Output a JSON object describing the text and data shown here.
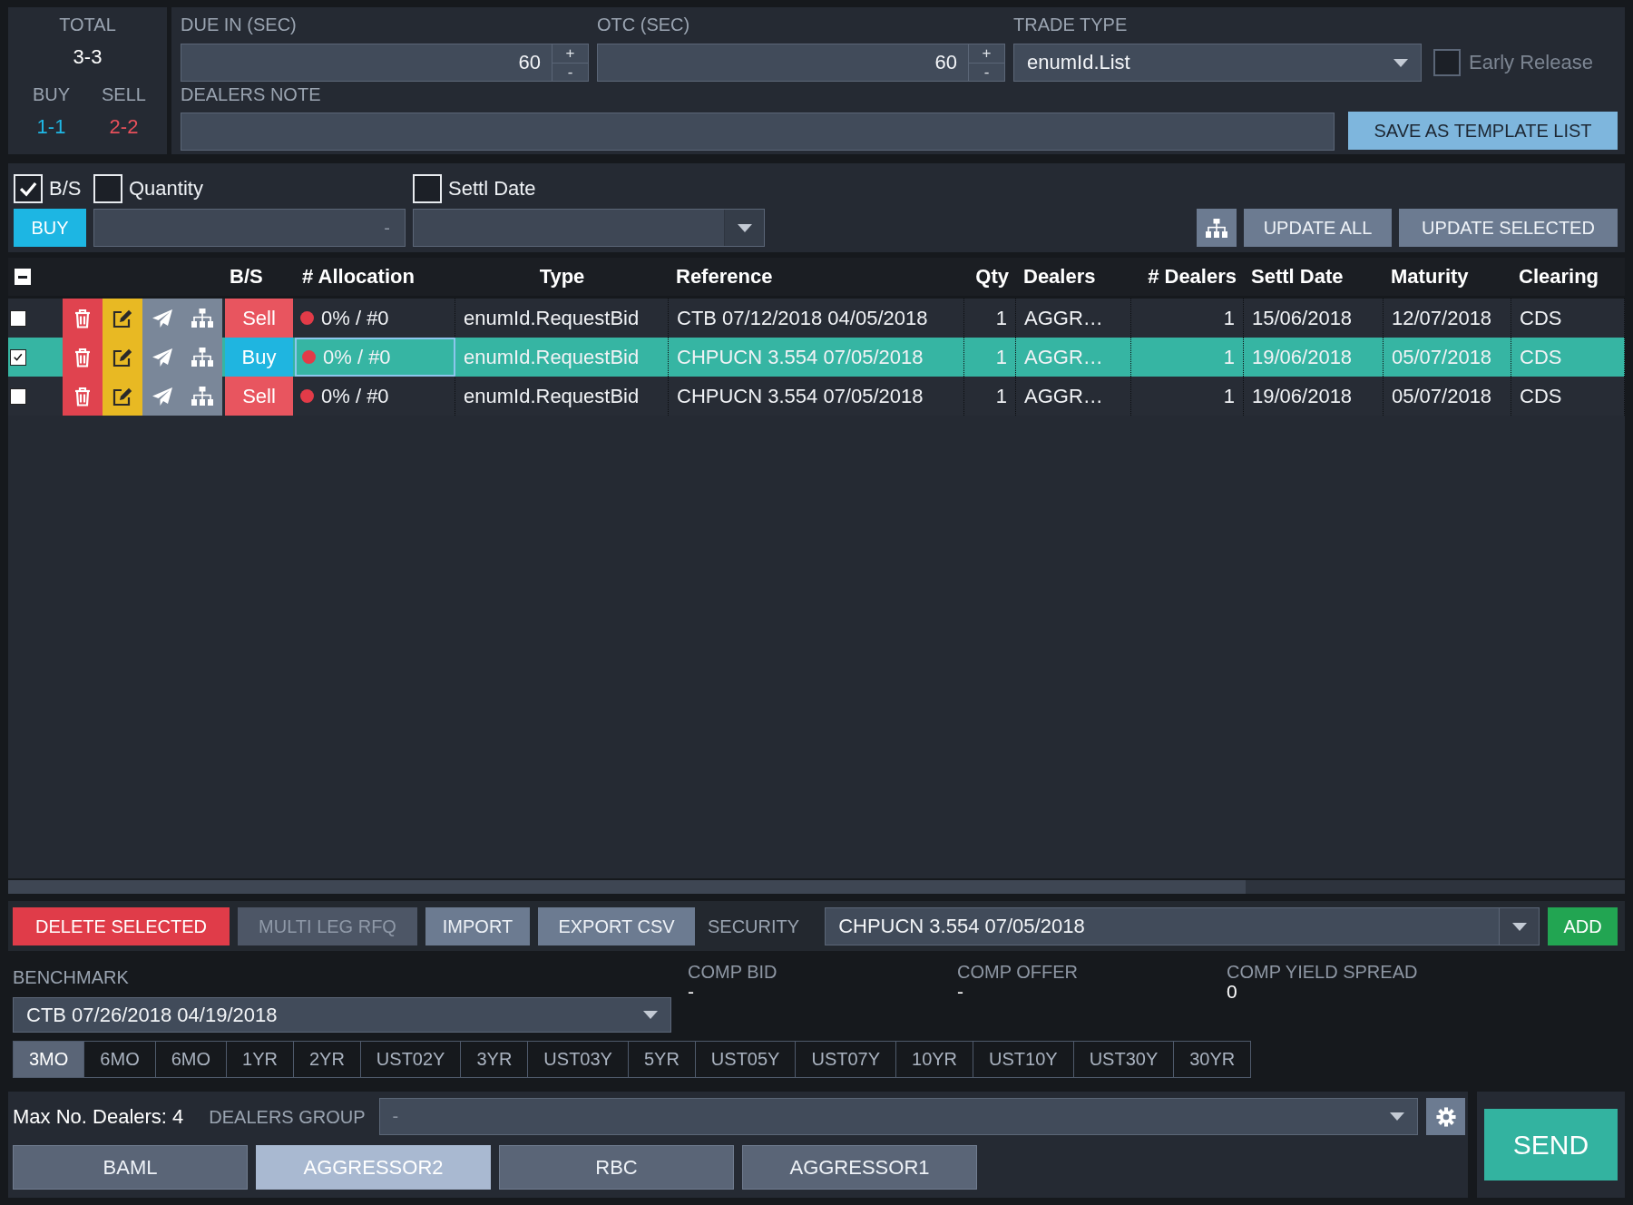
{
  "summary": {
    "total_label": "TOTAL",
    "total": "3-3",
    "buy_label": "BUY",
    "sell_label": "SELL",
    "buy": "1-1",
    "sell": "2-2"
  },
  "rfq_settings": {
    "due_in": {
      "label": "DUE IN (SEC)",
      "value": "60",
      "increment": "+",
      "decrement": "-"
    },
    "otc": {
      "label": "OTC (SEC)",
      "value": "60",
      "increment": "+",
      "decrement": "-"
    },
    "trade_type": {
      "label": "TRADE TYPE",
      "value": "enumId.List"
    },
    "early_release": {
      "label": "Early Release",
      "checked": false,
      "disabled": true
    },
    "dealers_note": {
      "label": "DEALERS NOTE"
    },
    "save_template_button": "SAVE AS TEMPLATE LIST"
  },
  "bulk_update": {
    "fields": [
      {
        "label": "B/S",
        "checked": true
      },
      {
        "label": "Quantity",
        "checked": false
      },
      {
        "label": "Settl Date",
        "checked": false
      }
    ],
    "side_button": "BUY",
    "quantity": {
      "placeholder": "-"
    },
    "buttons": [
      "UPDATE ALL",
      "UPDATE SELECTED"
    ]
  },
  "table": {
    "select_all": {
      "indeterminate": true
    },
    "columns": [
      "B/S",
      "# Allocation",
      "Type",
      "Reference",
      "Qty",
      "Dealers",
      "# Dealers",
      "Settl Date",
      "Maturity",
      "Clearing"
    ],
    "rows": [
      {
        "checked": false,
        "selected": false,
        "side": {
          "label": "Sell",
          "color": "#e8555f"
        },
        "allocation": {
          "text": "0% / #0",
          "color": "#e23b48",
          "focused": false
        },
        "type": "enumId.RequestBid",
        "reference": "CTB 07/12/2018 04/05/2018",
        "qty": "1",
        "dealers": "AGGR…",
        "dealer_count": "1",
        "settl_date": "15/06/2018",
        "maturity": "12/07/2018",
        "clearing": "CDS"
      },
      {
        "checked": true,
        "selected": true,
        "side": {
          "label": "Buy",
          "color": "#1fb5e0"
        },
        "allocation": {
          "text": "0% / #0",
          "color": "#e23b48",
          "focused": true
        },
        "type": "enumId.RequestBid",
        "reference": "CHPUCN 3.554 07/05/2018",
        "qty": "1",
        "dealers": "AGGR…",
        "dealer_count": "1",
        "settl_date": "19/06/2018",
        "maturity": "05/07/2018",
        "clearing": "CDS"
      },
      {
        "checked": false,
        "selected": false,
        "side": {
          "label": "Sell",
          "color": "#e8555f"
        },
        "allocation": {
          "text": "0% / #0",
          "color": "#e23b48",
          "focused": false
        },
        "type": "enumId.RequestBid",
        "reference": "CHPUCN 3.554 07/05/2018",
        "qty": "1",
        "dealers": "AGGR…",
        "dealer_count": "1",
        "settl_date": "19/06/2018",
        "maturity": "05/07/2018",
        "clearing": "CDS"
      }
    ]
  },
  "actions": {
    "buttons": [
      {
        "label": "DELETE SELECTED",
        "kind": "danger",
        "disabled": false
      },
      {
        "label": "MULTI LEG RFQ",
        "kind": "secondary",
        "disabled": true
      },
      {
        "label": "IMPORT",
        "kind": "secondary",
        "disabled": false
      },
      {
        "label": "EXPORT CSV",
        "kind": "secondary",
        "disabled": false
      }
    ],
    "security": {
      "label": "SECURITY",
      "value": "CHPUCN 3.554 07/05/2018"
    },
    "add_button": "ADD"
  },
  "benchmark": {
    "label": "BENCHMARK",
    "value": "CTB 07/26/2018 04/19/2018",
    "comparisons": [
      {
        "label": "COMP BID",
        "value": "-"
      },
      {
        "label": "COMP OFFER",
        "value": "-"
      },
      {
        "label": "COMP YIELD SPREAD",
        "value": "0"
      }
    ],
    "tenors": [
      {
        "label": "3MO",
        "selected": true
      },
      {
        "label": "6MO",
        "selected": false
      },
      {
        "label": "6MO",
        "selected": false
      },
      {
        "label": "1YR",
        "selected": false
      },
      {
        "label": "2YR",
        "selected": false
      },
      {
        "label": "UST02Y",
        "selected": false
      },
      {
        "label": "3YR",
        "selected": false
      },
      {
        "label": "UST03Y",
        "selected": false
      },
      {
        "label": "5YR",
        "selected": false
      },
      {
        "label": "UST05Y",
        "selected": false
      },
      {
        "label": "UST07Y",
        "selected": false
      },
      {
        "label": "10YR",
        "selected": false
      },
      {
        "label": "UST10Y",
        "selected": false
      },
      {
        "label": "UST30Y",
        "selected": false
      },
      {
        "label": "30YR",
        "selected": false
      }
    ]
  },
  "dealers": {
    "max_dealers": "Max No. Dealers: 4",
    "group_label": "DEALERS GROUP",
    "group": {
      "placeholder": "-"
    },
    "list": [
      {
        "label": "BAML",
        "selected": false
      },
      {
        "label": "AGGRESSOR2",
        "selected": true
      },
      {
        "label": "RBC",
        "selected": false
      },
      {
        "label": "AGGRESSOR1",
        "selected": false
      }
    ]
  },
  "send_button": "SEND"
}
